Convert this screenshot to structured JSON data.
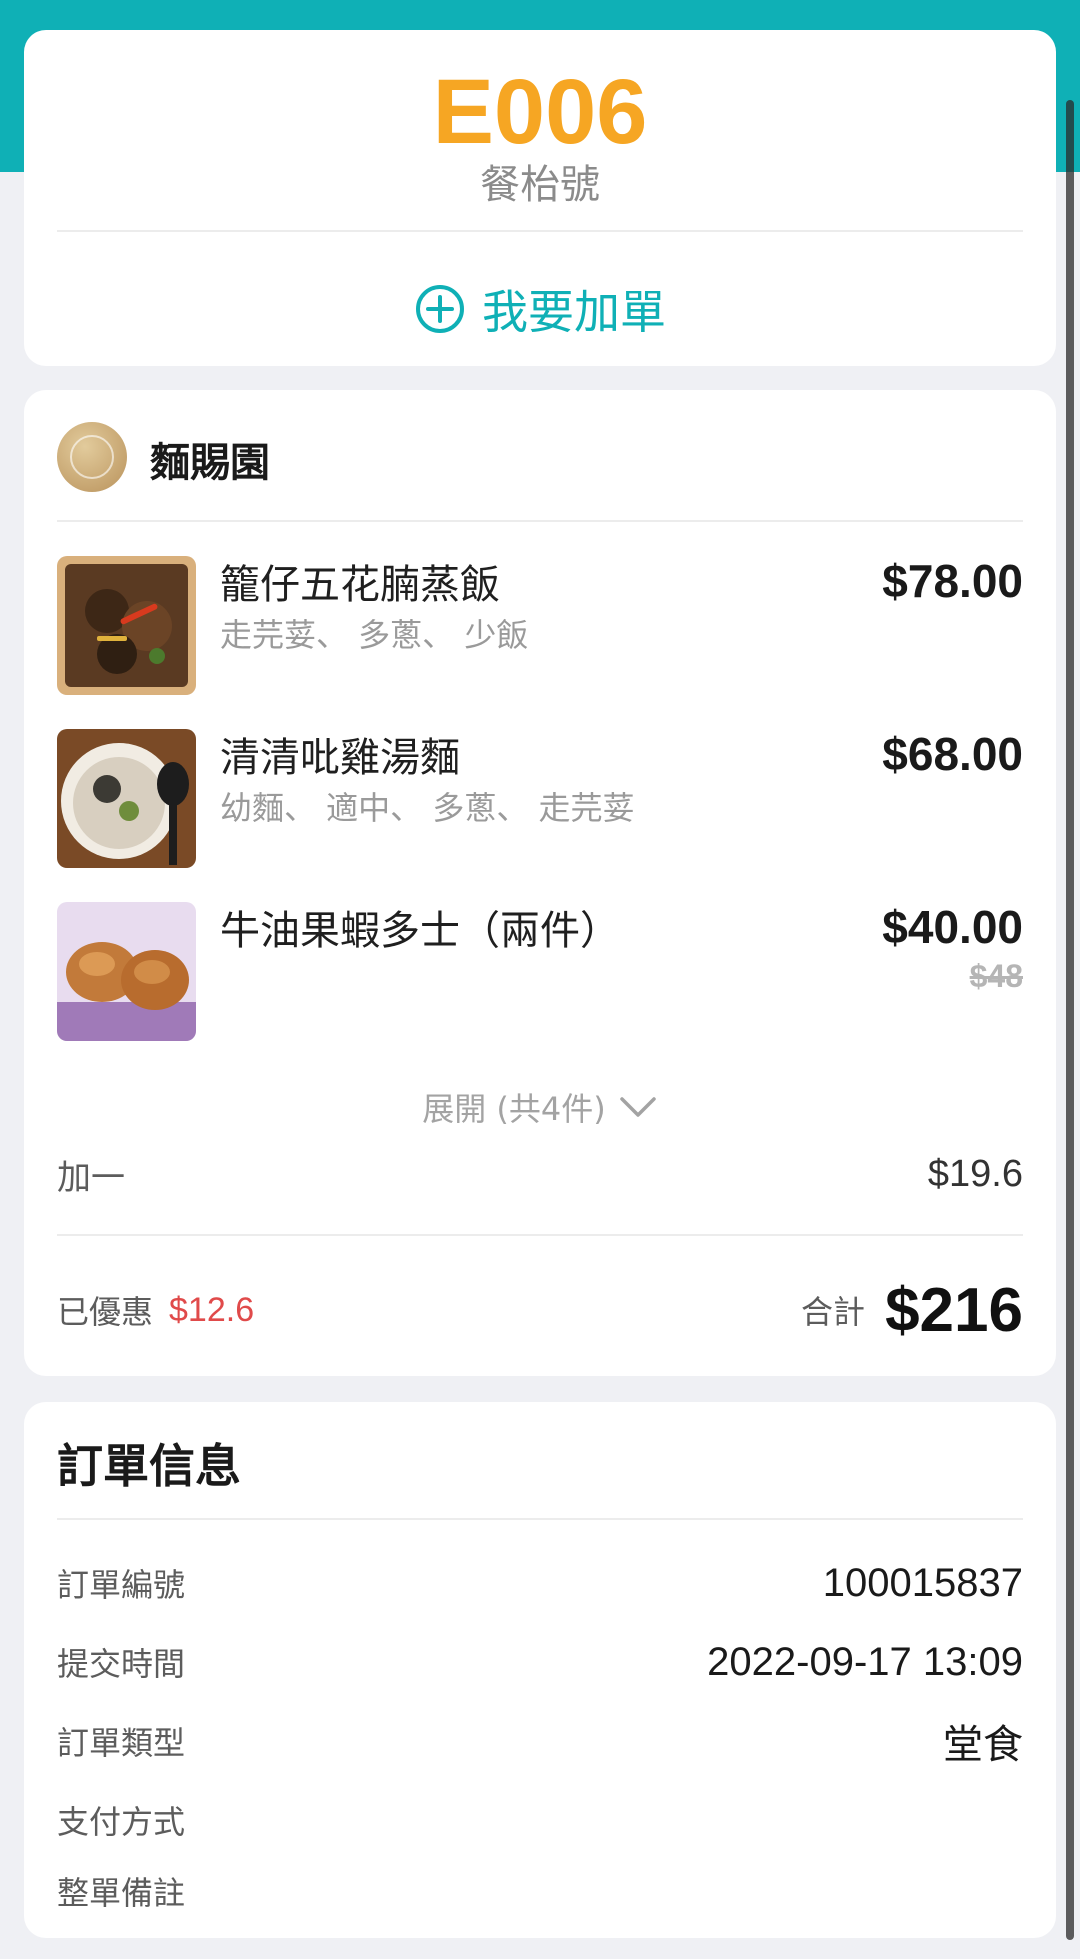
{
  "table": {
    "number": "E006",
    "label": "餐枱號",
    "add_order_label": "我要加單"
  },
  "shop": {
    "name": "麵賜園",
    "items": [
      {
        "name": "籠仔五花腩蒸飯",
        "options": "走芫荽、 多蔥、 少飯",
        "price": "$78.00",
        "original_price": ""
      },
      {
        "name": "清清吡雞湯麵",
        "options": "幼麵、 適中、 多蔥、 走芫荽",
        "price": "$68.00",
        "original_price": ""
      },
      {
        "name": "牛油果蝦多士（兩件）",
        "options": "",
        "price": "$40.00",
        "original_price": "$48"
      }
    ],
    "expand_label": "展開 (共4件)",
    "surcharge": {
      "label": "加一",
      "value": "$19.6"
    },
    "discount": {
      "label": "已優惠",
      "value": "$12.6"
    },
    "total": {
      "label": "合計",
      "value": "$216"
    }
  },
  "order_info": {
    "title": "訂單信息",
    "rows": [
      {
        "label": "訂單編號",
        "value": "100015837"
      },
      {
        "label": "提交時間",
        "value": "2022-09-17 13:09"
      },
      {
        "label": "訂單類型",
        "value": "堂食"
      },
      {
        "label": "支付方式",
        "value": ""
      },
      {
        "label": "整單備註",
        "value": ""
      }
    ]
  },
  "colors": {
    "accent": "#0fb0b6",
    "table_number": "#f6a623",
    "discount": "#e04a4a"
  },
  "icons": {
    "add": "plus-circle-icon",
    "expand": "chevron-down-icon",
    "shop_logo": "shop-logo"
  }
}
